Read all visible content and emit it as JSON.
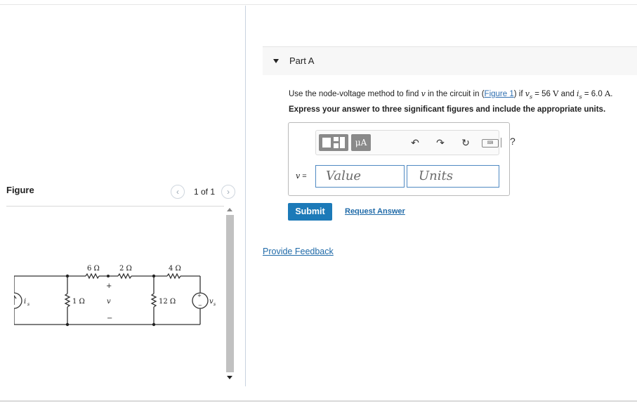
{
  "figure_panel": {
    "title": "Figure",
    "pager_text": "1 of 1",
    "prev_icon": "chevron-left-icon",
    "next_icon": "chevron-right-icon",
    "circuit": {
      "resistors": [
        "6 Ω",
        "2 Ω",
        "4 Ω",
        "1 Ω",
        "12 Ω"
      ],
      "source_current_label": "i",
      "source_current_sub": "s",
      "source_voltage_label": "v",
      "source_voltage_sub": "s",
      "node_voltage": "v",
      "plus": "+",
      "minus": "−"
    }
  },
  "part": {
    "title": "Part A",
    "prompt_pre": "Use the node-voltage method to find ",
    "prompt_var": "v",
    "prompt_mid": " in the circuit in (",
    "figure_link": "Figure 1",
    "prompt_after_link": ") if ",
    "vs_symbol": "v",
    "vs_sub": "s",
    "vs_value": " = 56 ",
    "vs_unit": "V",
    "and_text": " and ",
    "is_symbol": "i",
    "is_sub": "s",
    "is_value": " = 6.0 ",
    "is_unit": "A",
    "period": ".",
    "instruction": "Express your answer to three significant figures and include the appropriate units."
  },
  "answer": {
    "variable_label": "v",
    "equals": " =",
    "value_placeholder": "Value",
    "units_placeholder": "Units",
    "toolbar": {
      "mu_label": "μA",
      "help_label": "?"
    }
  },
  "actions": {
    "submit": "Submit",
    "request_answer": "Request Answer",
    "feedback": "Provide Feedback"
  }
}
